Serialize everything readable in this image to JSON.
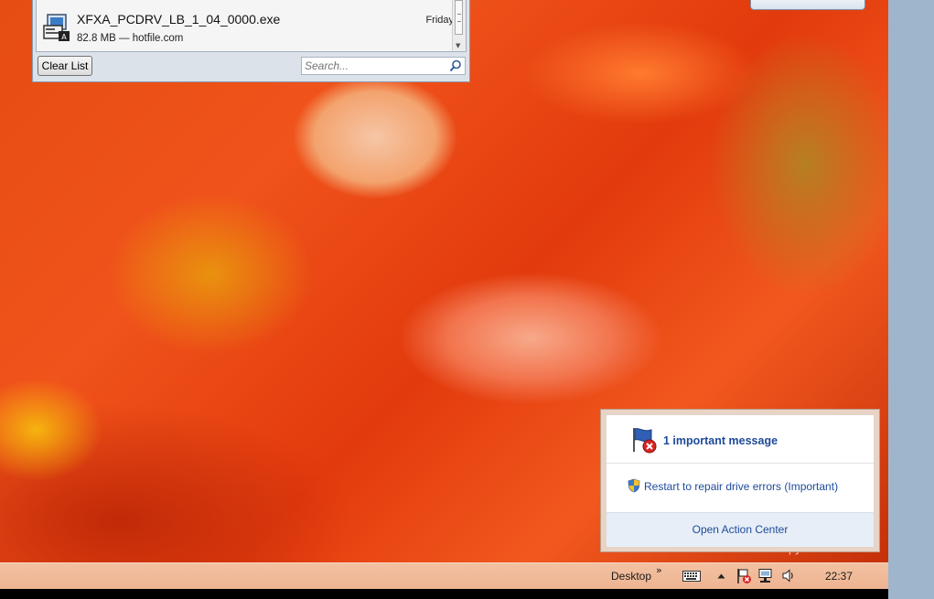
{
  "downloads": {
    "item": {
      "file_name": "XFXA_PCDRV_LB_1_04_0000.exe",
      "meta": "82.8 MB — hotfile.com",
      "date": "Friday"
    },
    "clear_list_label": "Clear List",
    "search_placeholder": "Search..."
  },
  "notification": {
    "title": "1 important message",
    "message": "Restart to repair drive errors (Important)",
    "footer_link": "Open Action Center"
  },
  "watermark": "Evaluation copy. Build 8250",
  "taskbar": {
    "toolbar_label": "Desktop",
    "chevron": "»",
    "clock": "22:37",
    "tray_icons": [
      "keyboard-icon",
      "show-hidden-icons-arrow",
      "action-center-flag-error-icon",
      "network-icon",
      "volume-icon"
    ]
  },
  "colors": {
    "link_blue": "#1e4a9a",
    "taskbar_bg": "#f0b894",
    "popup_footer_bg": "#e7eef7"
  }
}
